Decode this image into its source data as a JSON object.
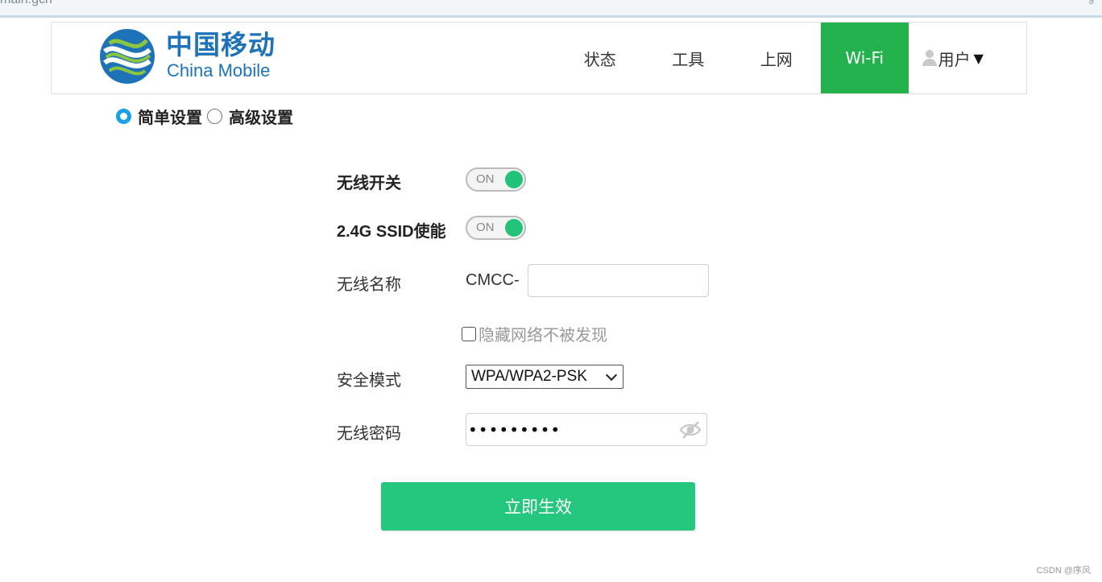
{
  "browser": {
    "url_fragment": "main.gch"
  },
  "brand": {
    "name_cn": "中国移动",
    "name_en": "China Mobile",
    "color": "#1d72b8",
    "accent_green": "#8cc63f"
  },
  "nav": {
    "items": [
      {
        "label": "状态",
        "active": false
      },
      {
        "label": "工具",
        "active": false
      },
      {
        "label": "上网",
        "active": false
      },
      {
        "label": "Wi-Fi",
        "active": true
      },
      {
        "label": "用户",
        "active": false
      }
    ],
    "user_caret": "▼",
    "active_color": "#23b14d"
  },
  "mode": {
    "simple_label": "简单设置",
    "advanced_label": "高级设置",
    "selected": "simple"
  },
  "form": {
    "wifi_switch_label": "无线开关",
    "wifi_switch_state": "ON",
    "ssid24_enable_label": "2.4G SSID使能",
    "ssid24_enable_state": "ON",
    "ssid_label": "无线名称",
    "ssid_prefix": "CMCC-",
    "ssid_value": "",
    "hide_network_label": "隐藏网络不被发现",
    "hide_network_checked": false,
    "security_label": "安全模式",
    "security_value": "WPA/WPA2-PSK",
    "password_label": "无线密码",
    "password_masked": "•••••••••",
    "submit_label": "立即生效",
    "toggle_color": "#23c279",
    "submit_color": "#25c67d"
  },
  "watermark": "CSDN @序风"
}
